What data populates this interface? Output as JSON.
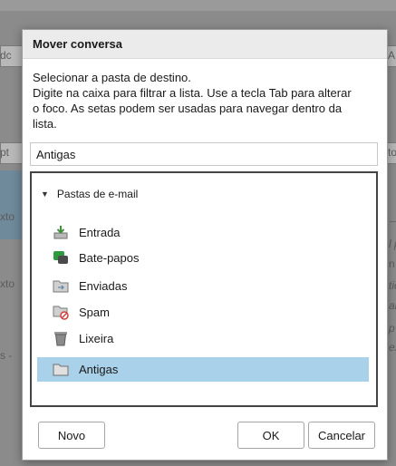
{
  "background": {
    "fragment_left_1": "dc",
    "fragment_right_1": "A",
    "fragment_left_2": "pt",
    "fragment_right_2": "to",
    "fragment_left_3": "xto",
    "fragment_left_4": "xto",
    "fragment_left_5": "s -",
    "fragment_right_3": "l p",
    "fragment_right_4": "n",
    "fragment_right_5": "tic",
    "fragment_right_6": "ar",
    "fragment_right_7": "p",
    "fragment_right_8": "ex"
  },
  "dialog": {
    "title": "Mover conversa",
    "instruction_lines": [
      "Selecionar a pasta de destino.",
      "Digite na caixa para filtrar a lista. Use a tecla Tab para alterar",
      "o foco. As setas podem ser usadas para navegar dentro da",
      "lista."
    ],
    "filter_value": "Antigas",
    "tree": {
      "root_label": "Pastas de e-mail",
      "items": [
        {
          "label": "Entrada",
          "icon": "inbox-icon",
          "selected": false
        },
        {
          "label": "Bate-papos",
          "icon": "chat-icon",
          "selected": false
        },
        {
          "label": "Enviadas",
          "icon": "sent-icon",
          "selected": false
        },
        {
          "label": "Spam",
          "icon": "spam-icon",
          "selected": false
        },
        {
          "label": "Lixeira",
          "icon": "trash-icon",
          "selected": false
        },
        {
          "label": "Antigas",
          "icon": "folder-icon",
          "selected": true
        }
      ]
    },
    "buttons": {
      "new_label": "Novo",
      "ok_label": "OK",
      "cancel_label": "Cancelar"
    }
  },
  "colors": {
    "selection": "#a9d1ea",
    "chat_green": "#2e9a3e"
  }
}
